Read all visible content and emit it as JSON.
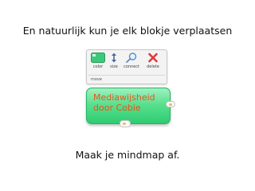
{
  "slide": {
    "heading": "En natuurlijk kun je elk blokje verplaatsen",
    "footer": "Maak je mindmap af."
  },
  "toolbar": {
    "tools": [
      {
        "label": "color",
        "icon": "color-swatch-icon"
      },
      {
        "label": "size",
        "icon": "size-arrows-icon"
      },
      {
        "label": "connect",
        "icon": "connect-magnifier-icon"
      },
      {
        "label": "delete",
        "icon": "delete-x-icon"
      }
    ],
    "move_label": "move"
  },
  "node": {
    "text": "Mediawijsheid\ndoor Cobie",
    "fill_color": "#2ecc71",
    "text_color": "#e7551a"
  }
}
